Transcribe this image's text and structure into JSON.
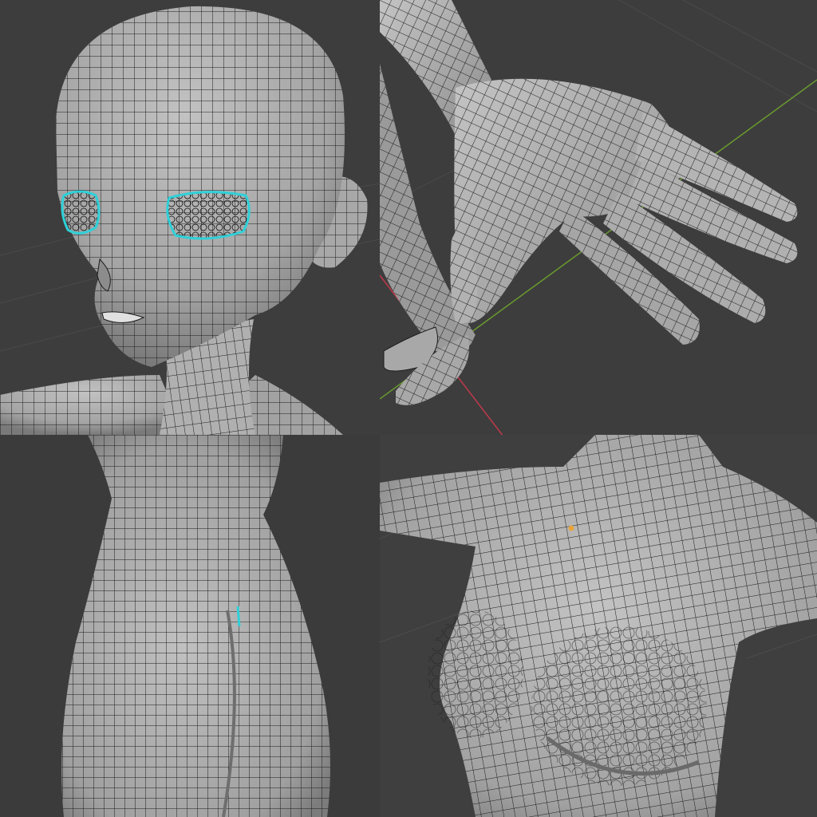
{
  "viewports": [
    {
      "id": "head",
      "subject": "head-mesh"
    },
    {
      "id": "hand",
      "subject": "hand-mesh"
    },
    {
      "id": "back",
      "subject": "back-torso-mesh"
    },
    {
      "id": "chest",
      "subject": "chest-torso-mesh"
    }
  ],
  "colors": {
    "viewport_bg": "#3d3d3d",
    "mesh_fill": "#a9a9a9",
    "mesh_shadow": "#7d7d7d",
    "wire": "#1a1a1a",
    "selected_edges": "#2fd0d8",
    "x_axis": "#c0394b",
    "y_axis": "#6a9a2e",
    "selected_vertex": "#e8a33a",
    "floor_grid": "#4a4a4a"
  }
}
